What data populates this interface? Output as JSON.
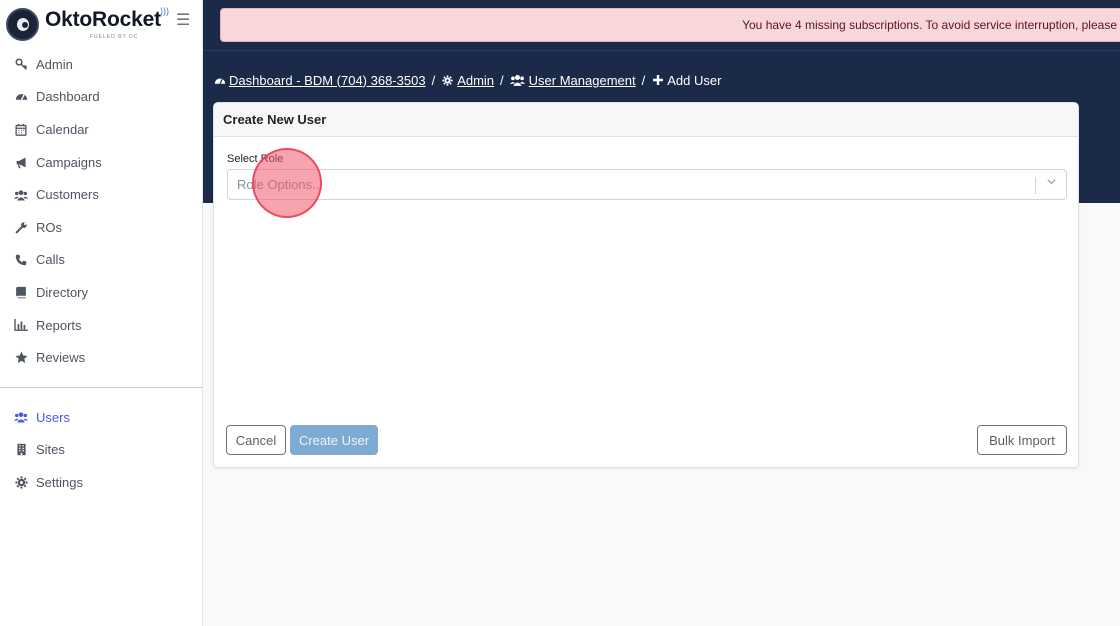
{
  "brand": {
    "name": "OktoRocket",
    "subtitle": "FUELED BY DC"
  },
  "sidebar": {
    "menu_icon": "hamburger-icon",
    "items": [
      {
        "label": "Admin",
        "icon": "key-icon"
      },
      {
        "label": "Dashboard",
        "icon": "gauge-icon"
      },
      {
        "label": "Calendar",
        "icon": "calendar-icon"
      },
      {
        "label": "Campaigns",
        "icon": "bullhorn-icon"
      },
      {
        "label": "Customers",
        "icon": "users-icon"
      },
      {
        "label": "ROs",
        "icon": "wrench-icon"
      },
      {
        "label": "Calls",
        "icon": "phone-icon"
      },
      {
        "label": "Directory",
        "icon": "book-icon"
      },
      {
        "label": "Reports",
        "icon": "bar-chart-icon"
      },
      {
        "label": "Reviews",
        "icon": "star-icon"
      }
    ],
    "secondary_items": [
      {
        "label": "Users",
        "icon": "users-icon",
        "active": true
      },
      {
        "label": "Sites",
        "icon": "building-icon"
      },
      {
        "label": "Settings",
        "icon": "gear-icon"
      }
    ]
  },
  "alert": {
    "text": "You have 4 missing subscriptions. To avoid service interruption, please"
  },
  "breadcrumb": {
    "dashboard": "Dashboard - BDM (704) 368-3503",
    "admin": "Admin",
    "user_management": "User Management",
    "current": "Add User",
    "separator": "/"
  },
  "card": {
    "title": "Create New User",
    "role_label": "Select Role",
    "role_placeholder": "Role Options...",
    "cancel_label": "Cancel",
    "create_label": "Create User",
    "bulk_label": "Bulk Import"
  },
  "colors": {
    "navy_header": "#1c2a4a",
    "active_nav": "#4a5bd4",
    "alert_bg": "#f8d7da",
    "create_button": "#7dabd1"
  }
}
